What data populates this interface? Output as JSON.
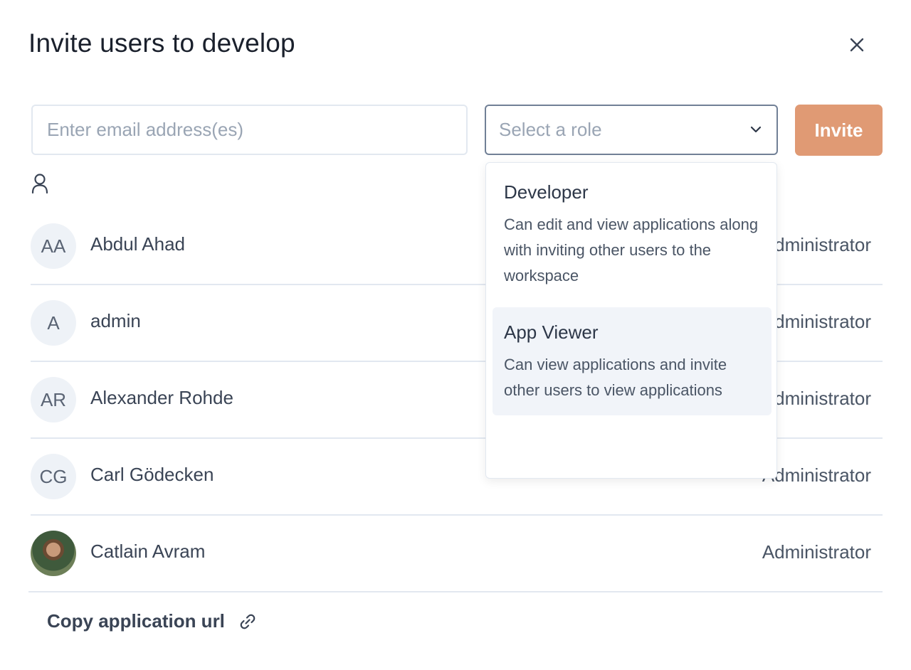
{
  "dialog": {
    "title": "Invite users to develop"
  },
  "form": {
    "email_placeholder": "Enter email address(es)",
    "role_placeholder": "Select a role",
    "invite_label": "Invite"
  },
  "role_dropdown": {
    "options": [
      {
        "title": "Developer",
        "description": "Can edit and view applications along with inviting other users to the workspace"
      },
      {
        "title": "App Viewer",
        "description": "Can view applications and invite other users to view applications",
        "highlighted": true
      }
    ]
  },
  "users": [
    {
      "initials": "AA",
      "name": "Abdul Ahad",
      "role": "Administrator"
    },
    {
      "initials": "A",
      "name": "admin",
      "role": "Administrator"
    },
    {
      "initials": "AR",
      "name": "Alexander Rohde",
      "role": "Administrator"
    },
    {
      "initials": "CG",
      "name": "Carl Gödecken",
      "role": "Administrator"
    },
    {
      "initials": "",
      "name": "Catlain Avram",
      "role": "Administrator",
      "avatar": "photo"
    }
  ],
  "footer": {
    "copy_url_label": "Copy application url"
  },
  "colors": {
    "invite_button": "#e09a74",
    "highlight": "#f1f4f9",
    "divider": "#e2e8f0"
  },
  "icons": {
    "close": "close-icon",
    "chevron": "chevron-down-icon",
    "user": "user-icon",
    "link": "link-icon"
  }
}
